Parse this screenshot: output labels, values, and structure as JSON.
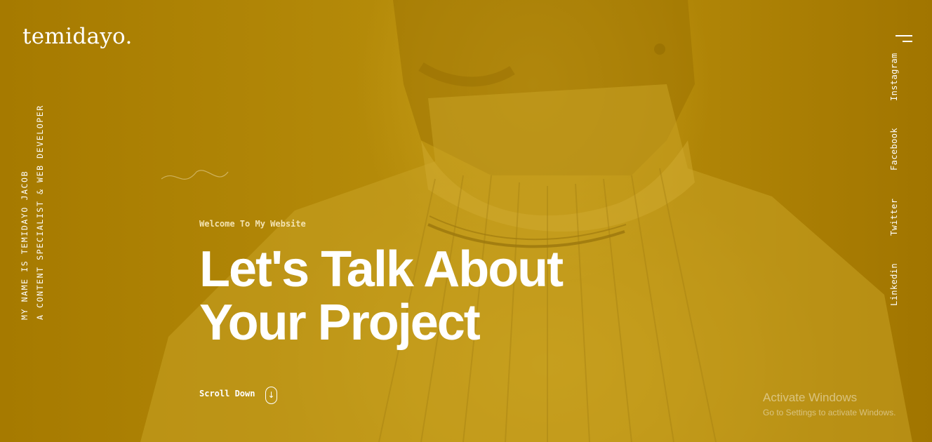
{
  "brand": {
    "logo": "temidayo."
  },
  "intro": {
    "line1": "MY NAME IS TEMIDAYO JACOB",
    "line2": "A CONTENT SPECIALIST & WEB DEVELOPER"
  },
  "social": [
    "Instagram",
    "Facebook",
    "Twitter",
    "Linkedin"
  ],
  "hero": {
    "welcome": "Welcome To My Website",
    "headline_line1": "Let's Talk About",
    "headline_line2": "Your Project",
    "scroll_label": "Scroll Down",
    "scroll_icon": "↓"
  },
  "watermark": {
    "title": "Activate Windows",
    "subtitle": "Go to Settings to activate Windows."
  },
  "colors": {
    "overlay": "#a87c00",
    "text": "#ffffff",
    "welcome_text": "#f3e3b2"
  },
  "icons": {
    "menu": "hamburger-menu-icon",
    "scroll": "arrow-down-icon"
  }
}
